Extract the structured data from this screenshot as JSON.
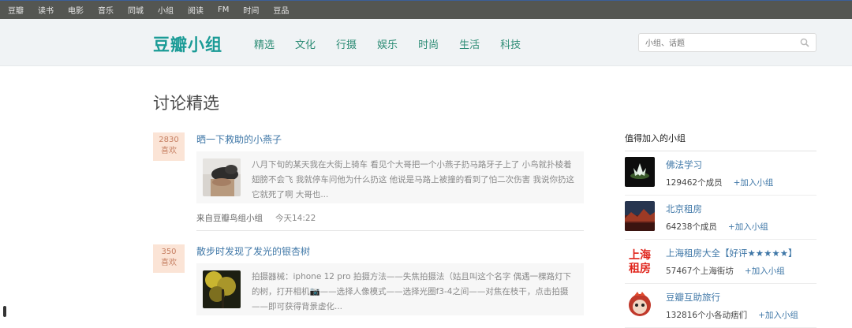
{
  "topbar": [
    "豆瓣",
    "读书",
    "电影",
    "音乐",
    "同城",
    "小组",
    "阅读",
    "FM",
    "时间",
    "豆品"
  ],
  "header": {
    "logo": "豆瓣小组",
    "nav": [
      "精选",
      "文化",
      "行摄",
      "娱乐",
      "时尚",
      "生活",
      "科技"
    ],
    "search_placeholder": "小组、话题"
  },
  "main": {
    "title": "讨论精选",
    "topics": [
      {
        "count": "2830",
        "count_label": "喜欢",
        "title": "晒一下救助的小燕子",
        "excerpt": "八月下旬的某天我在大街上骑车 看见个大哥把一个小燕子扔马路牙子上了 小鸟就扑棱着翅膀不会飞 我就停车问他为什么扔这 他说是马路上被撞的看到了怕二次伤害 我说你扔这它就死了啊 大哥也...",
        "source": "来自豆瓣鸟组小组",
        "time": "今天14:22"
      },
      {
        "count": "350",
        "count_label": "喜欢",
        "title": "散步时发现了发光的银杏树",
        "excerpt": "拍摄器械：iphone 12 pro 拍摄方法——失焦拍摄法（姑且叫这个名字 偶遇一棵路灯下的树，打开相机📷——选择人像模式——选择光圈f3-4之间——对焦在枝干，点击拍摄——即可获得背景虚化..."
      }
    ]
  },
  "sidebar": {
    "title": "值得加入的小组",
    "join_label": "+加入小组",
    "groups": [
      {
        "name": "佛法学习",
        "members": "129462个成员"
      },
      {
        "name": "北京租房",
        "members": "64238个成员"
      },
      {
        "name": "上海租房大全【好评★★★★★】",
        "members": "57467个上海街坊"
      },
      {
        "name": "豆瓣互助旅行",
        "members": "132816个小各动痞们"
      }
    ],
    "avatar3_text": [
      "上海",
      "租房"
    ]
  }
}
